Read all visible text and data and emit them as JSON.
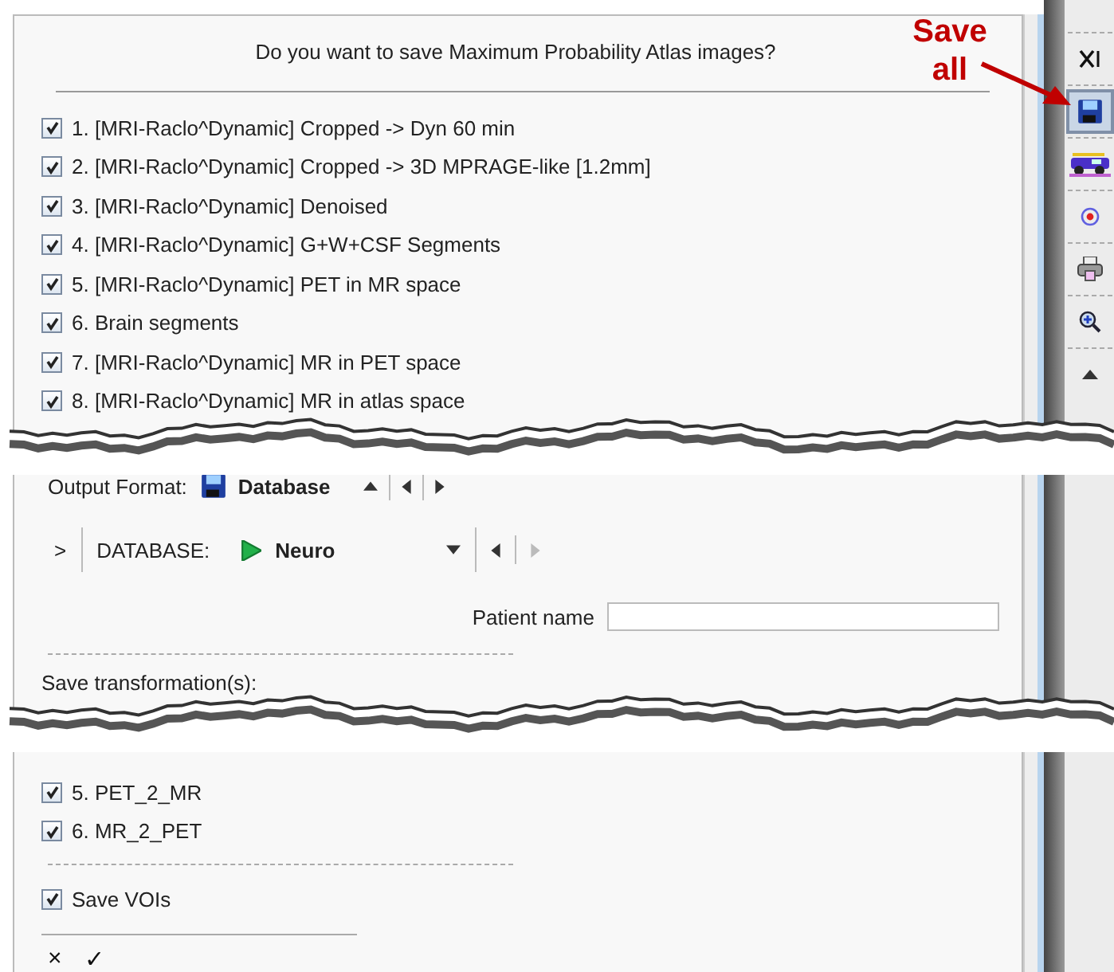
{
  "dialog": {
    "question": "Do you want to save Maximum Probability Atlas images?",
    "images": [
      {
        "label": "1. [MRI-Raclo^Dynamic] Cropped -> Dyn 60 min",
        "checked": true
      },
      {
        "label": "2. [MRI-Raclo^Dynamic] Cropped -> 3D MPRAGE-like [1.2mm]",
        "checked": true
      },
      {
        "label": "3. [MRI-Raclo^Dynamic] Denoised",
        "checked": true
      },
      {
        "label": "4. [MRI-Raclo^Dynamic] G+W+CSF Segments",
        "checked": true
      },
      {
        "label": "5. [MRI-Raclo^Dynamic] PET in MR space",
        "checked": true
      },
      {
        "label": "6. Brain segments",
        "checked": true
      },
      {
        "label": "7. [MRI-Raclo^Dynamic] MR in PET space",
        "checked": true
      },
      {
        "label": "8. [MRI-Raclo^Dynamic] MR in atlas space",
        "checked": true
      }
    ],
    "output_format": {
      "label": "Output Format:",
      "value": "Database"
    },
    "database": {
      "expander": ">",
      "label": "DATABASE:",
      "value": "Neuro"
    },
    "patient_name": {
      "label": "Patient name"
    },
    "transformations": {
      "label": "Save transformation(s):",
      "items": [
        {
          "label": "5. PET_2_MR",
          "checked": true
        },
        {
          "label": "6. MR_2_PET",
          "checked": true
        }
      ]
    },
    "save_vois": {
      "label": "Save VOIs",
      "checked": true
    },
    "buttons": [
      "×",
      "✓"
    ]
  },
  "toolbar": [
    {
      "kind": "close",
      "selected": false
    },
    {
      "kind": "save",
      "selected": true
    },
    {
      "kind": "truck",
      "selected": false
    },
    {
      "kind": "target",
      "selected": false
    },
    {
      "kind": "printer",
      "selected": false
    },
    {
      "kind": "zoom",
      "selected": false
    },
    {
      "kind": "up",
      "selected": false
    }
  ],
  "annotation": {
    "text": "Save all"
  }
}
